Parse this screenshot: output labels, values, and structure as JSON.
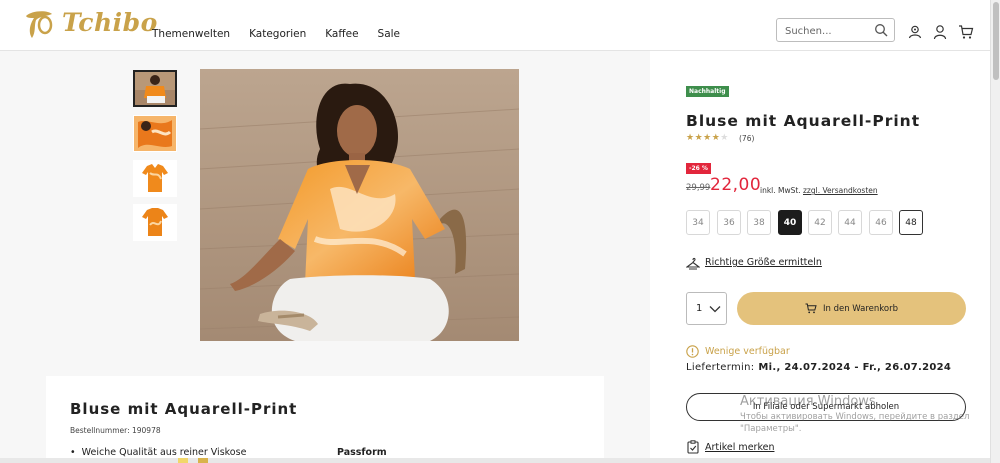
{
  "header": {
    "logo_text": "Tchibo",
    "nav": [
      "Themenwelten",
      "Kategorien",
      "Kaffee",
      "Sale"
    ],
    "search_placeholder": "Suchen..."
  },
  "product": {
    "sustainability_badge": "Nachhaltig",
    "title": "Bluse mit Aquarell-Print",
    "rating": 4,
    "reviews": "(76)",
    "discount_badge": "-26 %",
    "old_price": "29,99",
    "new_price": "22,00",
    "vat_note": "inkl. MwSt.",
    "shipping_link": "zzgl. Versandkosten",
    "sizes": [
      {
        "label": "34",
        "state": "unavailable"
      },
      {
        "label": "36",
        "state": "unavailable"
      },
      {
        "label": "38",
        "state": "unavailable"
      },
      {
        "label": "40",
        "state": "selected"
      },
      {
        "label": "42",
        "state": "unavailable"
      },
      {
        "label": "44",
        "state": "unavailable"
      },
      {
        "label": "46",
        "state": "unavailable"
      },
      {
        "label": "48",
        "state": "available"
      }
    ],
    "size_finder": "Richtige Größe ermitteln",
    "quantity": "1",
    "add_to_cart": "In den Warenkorb",
    "availability": "Wenige verfügbar",
    "delivery_label": "Liefertermin:",
    "delivery_dates": "Mi., 24.07.2024 - Fr., 26.07.2024",
    "store_pickup": "In Filiale oder Supermarkt abholen",
    "wishlist": "Artikel merken"
  },
  "info": {
    "title": "Bluse mit Aquarell-Print",
    "sku": "Bestellnummer: 190978",
    "bullet": "Weiche Qualität aus reiner Viskose",
    "passform": "Passform"
  },
  "watermark": {
    "line1": "Активация Windows",
    "line2": "Чтобы активировать Windows, перейдите в раздел",
    "line3": "\"Параметры\"."
  },
  "colors": {
    "brand_gold": "#c9a24a",
    "price_red": "#e2263c",
    "cart_button": "#e4c27c",
    "badge_green": "#3e8e4c"
  }
}
